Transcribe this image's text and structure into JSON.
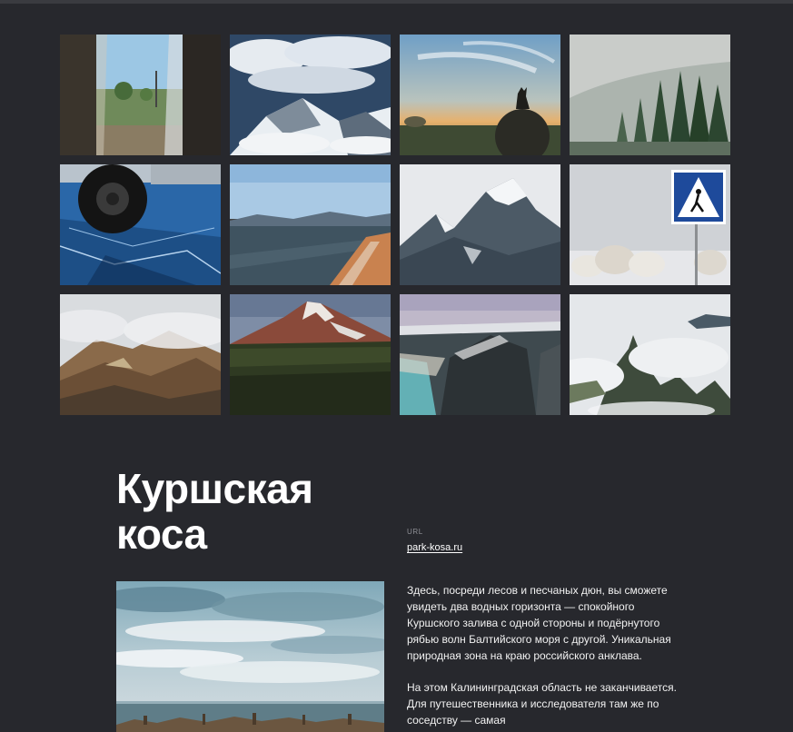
{
  "gallery": {
    "tiles": [
      {
        "name": "train-window-photo"
      },
      {
        "name": "clouds-over-mountains-photo"
      },
      {
        "name": "wolf-silhouette-sunset-photo"
      },
      {
        "name": "misty-forest-photo"
      },
      {
        "name": "car-wheel-on-ice-photo"
      },
      {
        "name": "lake-shore-mountains-photo"
      },
      {
        "name": "snowy-mountain-peak-photo"
      },
      {
        "name": "pedestrian-sign-photo"
      },
      {
        "name": "misty-hills-photo"
      },
      {
        "name": "volcano-photo"
      },
      {
        "name": "coastal-cliffs-photo"
      },
      {
        "name": "mountains-in-clouds-photo"
      }
    ]
  },
  "article": {
    "title_line1": "Куршская",
    "title_line2": "коса",
    "url_label": "URL",
    "url_text": "park-kosa.ru",
    "paragraph1": "Здесь, посреди лесов и песчаных дюн, вы сможете увидеть два водных горизонта — спокойного Куршского залива с одной стороны и подёрнутого рябью волн Балтийского моря с другой. Уникальная природная зона на краю российского анклава.",
    "paragraph2": "На этом Калининградская область не заканчивается. Для путешественника и исследователя там же по соседству — самая"
  }
}
